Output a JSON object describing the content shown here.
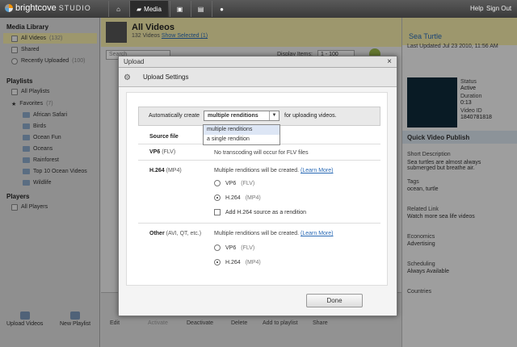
{
  "app": {
    "brand": "brightcove",
    "product": "STUDIO"
  },
  "topnav": {
    "media_label": "Media",
    "help": "Help",
    "sign_out": "Sign Out"
  },
  "sidebar": {
    "media_library": "Media Library",
    "items": [
      {
        "label": "All Videos",
        "count": "(132)"
      },
      {
        "label": "Shared",
        "count": ""
      },
      {
        "label": "Recently Uploaded",
        "count": "(100)"
      }
    ],
    "playlists_title": "Playlists",
    "all_playlists": "All Playlists",
    "favorites": "Favorites",
    "favorites_count": "(7)",
    "folders": [
      "African Safari",
      "Birds",
      "Ocean Fun",
      "Oceans",
      "Rainforest",
      "Top 10 Ocean Videos",
      "Wildlife"
    ],
    "players_title": "Players",
    "all_players": "All Players",
    "upload_videos": "Upload Videos",
    "new_playlist": "New Playlist"
  },
  "main": {
    "title": "All Videos",
    "subtitle": "132 Videos",
    "show_selected": "Show Selected (1)",
    "search_placeholder": "Search",
    "display_items": "Display Items:",
    "range": "1 - 100",
    "toolbar": [
      "Edit",
      "Activate",
      "Deactivate",
      "Delete",
      "Add to playlist",
      "Share"
    ]
  },
  "right": {
    "title": "Sea Turtle",
    "updated": "Last Updated Jul 23 2010, 11:56 AM",
    "status_label": "Status",
    "status": "Active",
    "duration_label": "Duration",
    "duration": "0:13",
    "video_id_label": "Video ID",
    "video_id": "1840781818",
    "quick_publish": "Quick Video Publish",
    "short_desc_label": "Short Description",
    "short_desc": "Sea turtles are almost always submerged but breathe air.",
    "tags_label": "Tags",
    "tags": "ocean, turtle",
    "related_label": "Related Link",
    "related": "Watch more sea life videos",
    "economics_label": "Economics",
    "economics": "Advertising",
    "scheduling_label": "Scheduling",
    "scheduling": "Always Available",
    "countries_label": "Countries"
  },
  "dialog": {
    "title": "Upload",
    "close": "×",
    "header": "Upload Settings",
    "auto_create": "Automatically create",
    "selected": "multiple renditions",
    "suffix": "for uploading videos.",
    "options": [
      "multiple renditions",
      "a single rendition"
    ],
    "source_file": "Source file",
    "vp6_label": "VP6",
    "vp6_sub": "(FLV)",
    "vp6_text": "No transcoding will occur for FLV files",
    "h264_label": "H.264",
    "h264_sub": "(MP4)",
    "multi_text": "Multiple renditions will be created.",
    "learn_more": "(Learn More)",
    "opt_vp6": "VP6",
    "opt_vp6_sub": "(FLV)",
    "opt_h264": "H.264",
    "opt_h264_sub": "(MP4)",
    "add_h264": "Add H.264 source as a rendition",
    "other_label": "Other",
    "other_sub": "(AVI, QT, etc.)",
    "done": "Done"
  }
}
